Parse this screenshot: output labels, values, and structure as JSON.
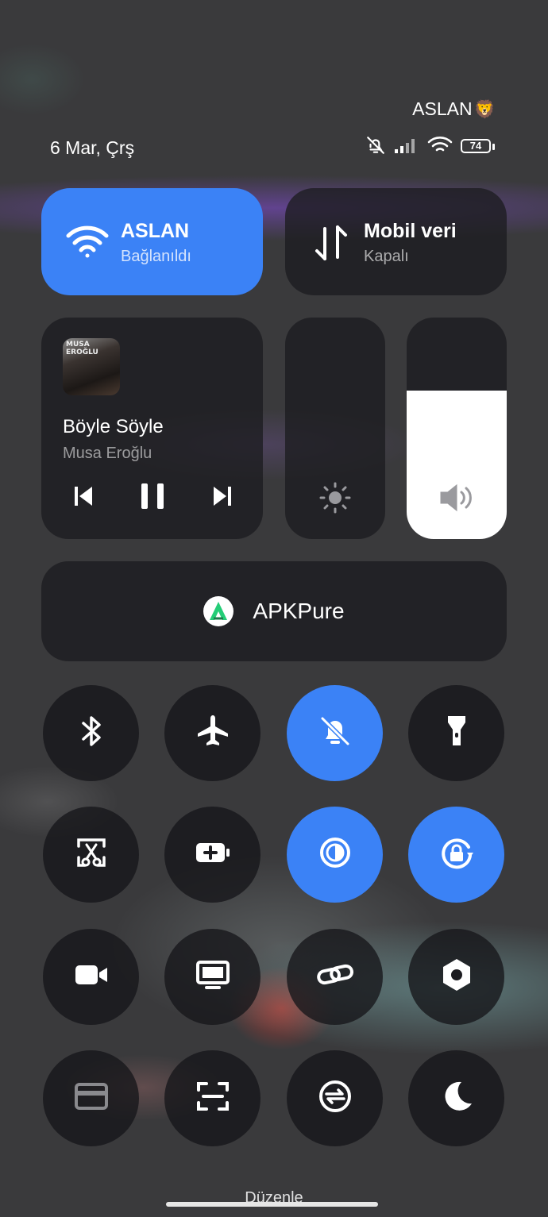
{
  "status_bar": {
    "carrier": "ASLAN",
    "carrier_emoji": "🦁",
    "date": "6 Mar, Çrş",
    "battery_percent": "74"
  },
  "wifi_tile": {
    "title": "ASLAN",
    "status": "Bağlanıldı",
    "icon": "wifi-icon",
    "active": true
  },
  "mobile_tile": {
    "title": "Mobil veri",
    "status": "Kapalı",
    "icon": "mobile-data-icon",
    "active": false
  },
  "media": {
    "album_art_text": "MUSA EROĞLU",
    "track": "Böyle Söyle",
    "artist": "Musa Eroğlu",
    "controls": [
      "previous-icon",
      "pause-icon",
      "next-icon"
    ]
  },
  "brightness": {
    "icon": "brightness-icon",
    "level": 0.0
  },
  "volume": {
    "icon": "volume-icon",
    "level": 0.67
  },
  "cast_app": {
    "name": "APKPure",
    "icon": "apkpure-icon"
  },
  "toggles": [
    {
      "icon": "bluetooth-icon",
      "active": false
    },
    {
      "icon": "airplane-icon",
      "active": false
    },
    {
      "icon": "mute-bell-icon",
      "active": true
    },
    {
      "icon": "flashlight-icon",
      "active": false
    },
    {
      "icon": "screenshot-icon",
      "active": false
    },
    {
      "icon": "battery-saver-icon",
      "active": false
    },
    {
      "icon": "dark-mode-icon",
      "active": true
    },
    {
      "icon": "rotation-lock-icon",
      "active": true
    },
    {
      "icon": "screen-record-icon",
      "active": false
    },
    {
      "icon": "cast-screen-icon",
      "active": false
    },
    {
      "icon": "link-icon",
      "active": false
    },
    {
      "icon": "settings-hex-icon",
      "active": false
    },
    {
      "icon": "card-icon",
      "active": false
    },
    {
      "icon": "scan-icon",
      "active": false
    },
    {
      "icon": "sync-icon",
      "active": false
    },
    {
      "icon": "moon-icon",
      "active": false
    }
  ],
  "footer": {
    "edit_label": "Düzenle"
  },
  "colors": {
    "accent": "#3b82f6",
    "tile_dark": "#1c1c20"
  }
}
